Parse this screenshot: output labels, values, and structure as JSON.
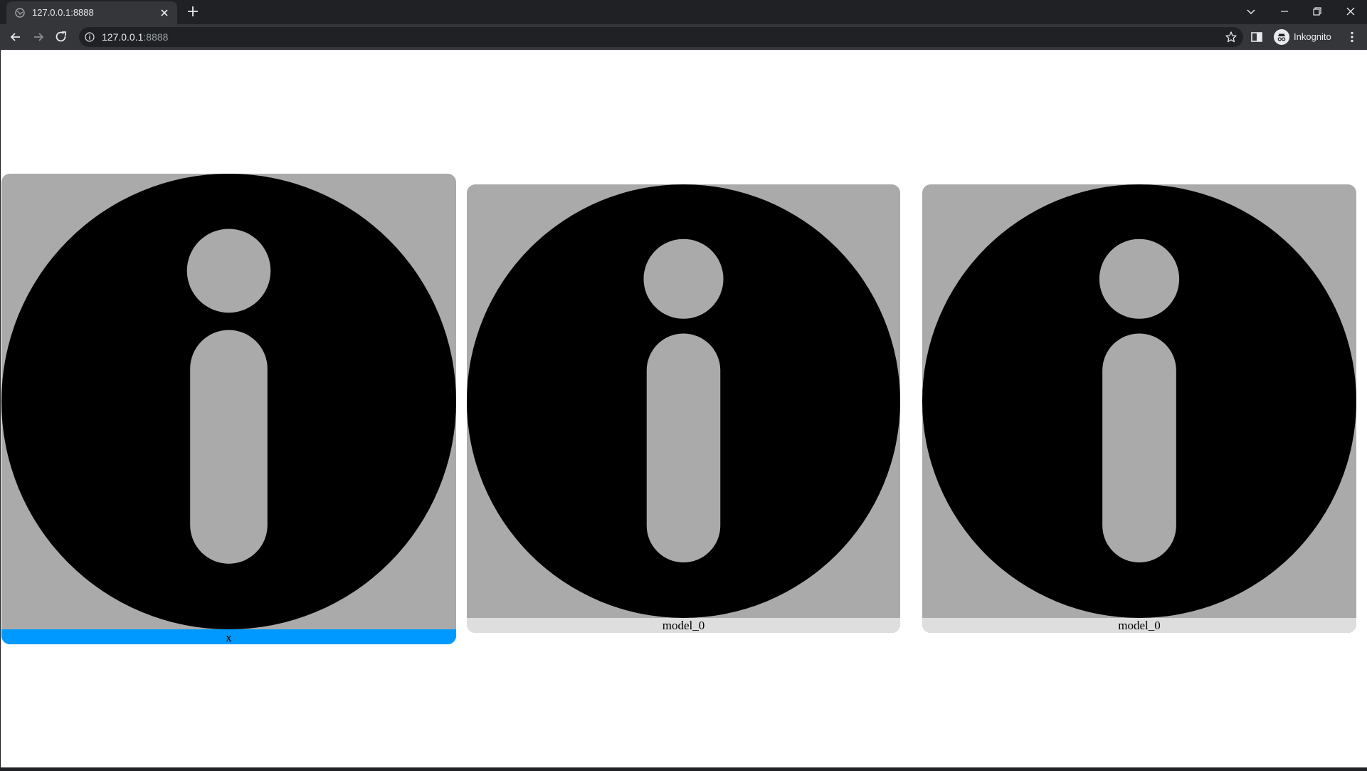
{
  "browser": {
    "tab_title": "127.0.0.1:8888",
    "url_host": "127.0.0.1",
    "url_port": ":8888",
    "profile_label": "Inkognito"
  },
  "cards": [
    {
      "caption": "x",
      "selected": true,
      "caption_color": "#0099ff"
    },
    {
      "caption": "model_0",
      "selected": false,
      "caption_color": "#dedede"
    },
    {
      "caption": "model_0",
      "selected": false,
      "caption_color": "#dedede"
    }
  ],
  "colors": {
    "image_background": "#aaaaaa",
    "icon_fill": "#000000",
    "chrome_dark": "#202124",
    "chrome_mid": "#35363a"
  },
  "icons": {
    "card_image": "info-circle-icon"
  }
}
